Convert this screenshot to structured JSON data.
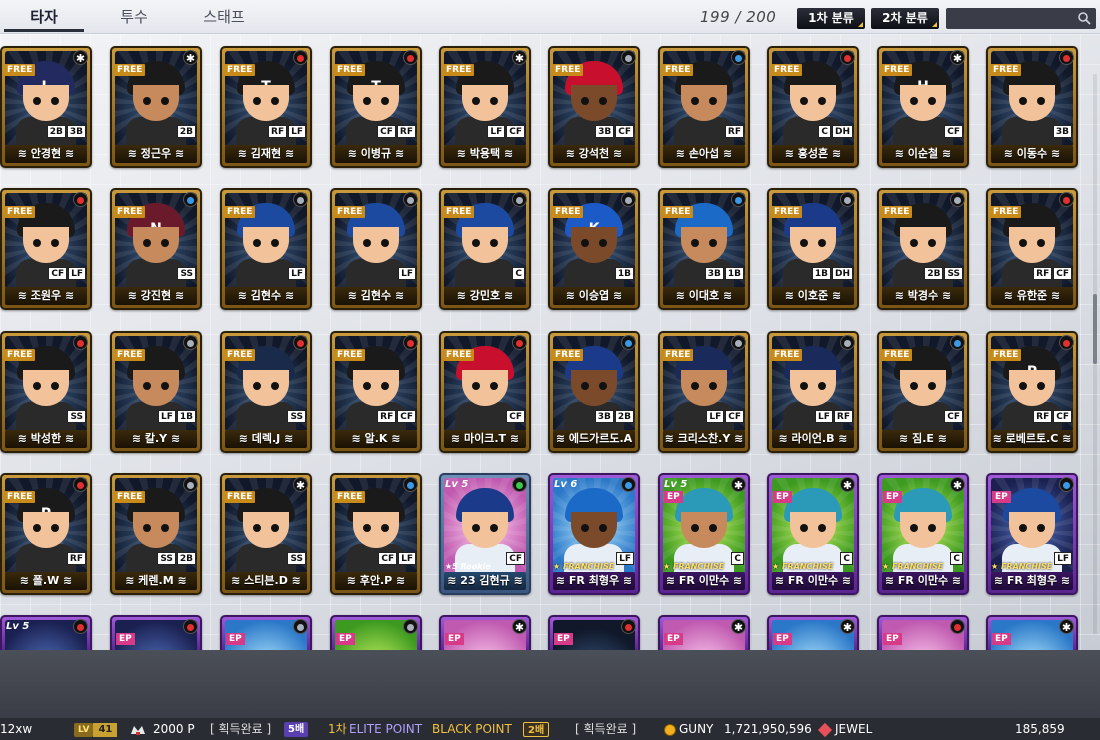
{
  "tabs": [
    {
      "label": "타자",
      "active": true
    },
    {
      "label": "투수",
      "active": false
    },
    {
      "label": "스태프",
      "active": false
    }
  ],
  "count": "199 / 200",
  "sort_buttons": [
    "1차 분류",
    "2차 분류"
  ],
  "search": {
    "placeholder": "",
    "icon": "search-icon"
  },
  "cards": [
    {
      "name": "안경현",
      "positions": [
        "2B",
        "3B"
      ],
      "tag": "FREE",
      "helmet": "#222a60",
      "logo": "L",
      "badge": "*"
    },
    {
      "name": "정근우",
      "positions": [
        "2B"
      ],
      "tag": "FREE",
      "helmet": "#1a1a1a",
      "logo": "",
      "badge": "*"
    },
    {
      "name": "김재현",
      "positions": [
        "RF",
        "LF"
      ],
      "tag": "FREE",
      "helmet": "#1a1a1a",
      "logo": "T",
      "badge": "red"
    },
    {
      "name": "이병규",
      "positions": [
        "CF",
        "RF"
      ],
      "tag": "FREE",
      "helmet": "#1a1a1a",
      "logo": "T",
      "badge": "red"
    },
    {
      "name": "박용택",
      "positions": [
        "LF",
        "CF"
      ],
      "tag": "FREE",
      "helmet": "#1a1a1a",
      "logo": "",
      "badge": "*"
    },
    {
      "name": "강석천",
      "positions": [
        "3B",
        "CF"
      ],
      "tag": "FREE",
      "helmet": "#c8102e",
      "logo": "",
      "badge": "grey"
    },
    {
      "name": "손아섭",
      "positions": [
        "RF"
      ],
      "tag": "FREE",
      "helmet": "#1a1a1a",
      "logo": "",
      "badge": "blue"
    },
    {
      "name": "홍성흔",
      "positions": [
        "C",
        "DH"
      ],
      "tag": "FREE",
      "helmet": "#1a1a1a",
      "logo": "",
      "badge": "red"
    },
    {
      "name": "이순철",
      "positions": [
        "CF"
      ],
      "tag": "FREE",
      "helmet": "#1a1a1a",
      "logo": "H",
      "badge": "*"
    },
    {
      "name": "이동수",
      "positions": [
        "3B"
      ],
      "tag": "FREE",
      "helmet": "#1a1a1a",
      "logo": "",
      "badge": "red"
    },
    {
      "name": "조원우",
      "positions": [
        "CF",
        "LF"
      ],
      "tag": "FREE",
      "helmet": "#1a1a1a",
      "logo": "",
      "badge": "red"
    },
    {
      "name": "강진현",
      "positions": [
        "SS"
      ],
      "tag": "FREE",
      "helmet": "#6a1a2a",
      "logo": "N",
      "badge": "blue"
    },
    {
      "name": "김현수",
      "positions": [
        "LF"
      ],
      "tag": "FREE",
      "helmet": "#1c4aa0",
      "logo": "",
      "badge": "grey"
    },
    {
      "name": "김현수",
      "positions": [
        "LF"
      ],
      "tag": "FREE",
      "helmet": "#1c4aa0",
      "logo": "",
      "badge": "grey"
    },
    {
      "name": "강민호",
      "positions": [
        "C"
      ],
      "tag": "FREE",
      "helmet": "#1c4aa0",
      "logo": "",
      "badge": "grey"
    },
    {
      "name": "이승엽",
      "positions": [
        "1B"
      ],
      "tag": "FREE",
      "helmet": "#1c5ac8",
      "logo": "K",
      "badge": "grey"
    },
    {
      "name": "이대호",
      "positions": [
        "3B",
        "1B"
      ],
      "tag": "FREE",
      "helmet": "#1c6ac8",
      "logo": "",
      "badge": "blue"
    },
    {
      "name": "이호준",
      "positions": [
        "1B",
        "DH"
      ],
      "tag": "FREE",
      "helmet": "#1c3a8a",
      "logo": "",
      "badge": "grey"
    },
    {
      "name": "박경수",
      "positions": [
        "2B",
        "SS"
      ],
      "tag": "FREE",
      "helmet": "#1a1a1a",
      "logo": "",
      "badge": "grey"
    },
    {
      "name": "유한준",
      "positions": [
        "RF",
        "CF"
      ],
      "tag": "FREE",
      "helmet": "#1a1a1a",
      "logo": "",
      "badge": "red"
    },
    {
      "name": "박성한",
      "positions": [
        "SS"
      ],
      "tag": "FREE",
      "helmet": "#1a1a1a",
      "logo": "",
      "badge": "red"
    },
    {
      "name": "칼.Y",
      "positions": [
        "LF",
        "1B"
      ],
      "tag": "FREE",
      "helmet": "#1a1a1a",
      "logo": "",
      "badge": "grey"
    },
    {
      "name": "데렉.J",
      "positions": [
        "SS"
      ],
      "tag": "FREE",
      "helmet": "#1a2a4a",
      "logo": "",
      "badge": "red"
    },
    {
      "name": "알.K",
      "positions": [
        "RF",
        "CF"
      ],
      "tag": "FREE",
      "helmet": "#1a1a1a",
      "logo": "",
      "badge": "red"
    },
    {
      "name": "마이크.T",
      "positions": [
        "CF"
      ],
      "tag": "FREE",
      "helmet": "#c8102e",
      "logo": "",
      "badge": "red"
    },
    {
      "name": "에드가르도.A",
      "positions": [
        "3B",
        "2B"
      ],
      "tag": "FREE",
      "helmet": "#1c3a8a",
      "logo": "",
      "badge": "blue"
    },
    {
      "name": "크리스찬.Y",
      "positions": [
        "LF",
        "CF"
      ],
      "tag": "FREE",
      "helmet": "#1a2a5a",
      "logo": "",
      "badge": "grey"
    },
    {
      "name": "라이언.B",
      "positions": [
        "LF",
        "RF"
      ],
      "tag": "FREE",
      "helmet": "#1a2a5a",
      "logo": "",
      "badge": "grey"
    },
    {
      "name": "짐.E",
      "positions": [
        "CF"
      ],
      "tag": "FREE",
      "helmet": "#1a1a1a",
      "logo": "",
      "badge": "blue"
    },
    {
      "name": "로베르토.C",
      "positions": [
        "RF",
        "CF"
      ],
      "tag": "FREE",
      "helmet": "#1a1a1a",
      "logo": "P",
      "badge": "red"
    },
    {
      "name": "폴.W",
      "positions": [
        "RF"
      ],
      "tag": "FREE",
      "helmet": "#1a1a1a",
      "logo": "P",
      "badge": "red"
    },
    {
      "name": "케렌.M",
      "positions": [
        "SS",
        "2B"
      ],
      "tag": "FREE",
      "helmet": "#1a1a1a",
      "logo": "",
      "badge": "grey"
    },
    {
      "name": "스티븐.D",
      "positions": [
        "SS"
      ],
      "tag": "FREE",
      "helmet": "#1a1a1a",
      "logo": "",
      "badge": "*"
    },
    {
      "name": "후안.P",
      "positions": [
        "CF",
        "LF"
      ],
      "tag": "FREE",
      "helmet": "#1a1a1a",
      "logo": "",
      "badge": "blue"
    },
    {
      "name": "23 김현규",
      "positions": [
        "CF"
      ],
      "tag": "",
      "helmet": "#1c3a8a",
      "logo": "",
      "badge": "green",
      "variant": "rookie",
      "lv": "Lv 5",
      "rookie": "5 Rookie"
    },
    {
      "name": "FR 최형우",
      "positions": [
        "LF"
      ],
      "tag": "",
      "helmet": "#1c6ac8",
      "logo": "",
      "badge": "blue",
      "variant": "fr",
      "lv": "Lv 6",
      "franchise": "FRANCHISE"
    },
    {
      "name": "FR 이만수",
      "positions": [
        "C"
      ],
      "tag": "EP",
      "helmet": "#2a9ab8",
      "logo": "",
      "badge": "*",
      "variant": "fr",
      "lv": "Lv 5",
      "franchise": "FRANCHISE"
    },
    {
      "name": "FR 이만수",
      "positions": [
        "C"
      ],
      "tag": "EP",
      "helmet": "#2a9ab8",
      "logo": "",
      "badge": "*",
      "variant": "fr",
      "lv": "",
      "franchise": "FRANCHISE"
    },
    {
      "name": "FR 이만수",
      "positions": [
        "C"
      ],
      "tag": "EP",
      "helmet": "#2a9ab8",
      "logo": "",
      "badge": "*",
      "variant": "fr",
      "lv": "",
      "franchise": "FRANCHISE"
    },
    {
      "name": "FR 최형우",
      "positions": [
        "LF"
      ],
      "tag": "EP",
      "helmet": "#1c4aa0",
      "logo": "",
      "badge": "blue",
      "variant": "fr",
      "lv": "",
      "franchise": "FRANCHISE"
    }
  ],
  "partial_row": [
    {
      "lv": "Lv 5",
      "tag": "",
      "badge": "red"
    },
    {
      "lv": "",
      "tag": "EP",
      "badge": "red"
    },
    {
      "lv": "",
      "tag": "EP",
      "badge": "grey"
    },
    {
      "lv": "",
      "tag": "EP",
      "badge": "grey"
    },
    {
      "lv": "",
      "tag": "EP",
      "badge": "*"
    },
    {
      "lv": "",
      "tag": "EP",
      "badge": "red"
    },
    {
      "lv": "",
      "tag": "EP",
      "badge": "*"
    },
    {
      "lv": "",
      "tag": "EP",
      "badge": "*"
    },
    {
      "lv": "",
      "tag": "EP",
      "badge": "red"
    },
    {
      "lv": "",
      "tag": "EP",
      "badge": "*"
    }
  ],
  "status": {
    "user": "12xw",
    "lv_label": "LV",
    "lv_value": "41",
    "points": "2000 P",
    "acquired_label_1": "[ 획득완료 ]",
    "mult_5": "5배",
    "elite_prefix": "1차",
    "elite": "ELITE POINT",
    "black": "BLACK POINT",
    "mult_2": "2배",
    "acquired_label_2": "[ 획득완료 ]",
    "guny_label": "GUNY",
    "guny_value": "1,721,950,596",
    "jewel_label": "JEWEL",
    "jewel_value": "185,859"
  }
}
